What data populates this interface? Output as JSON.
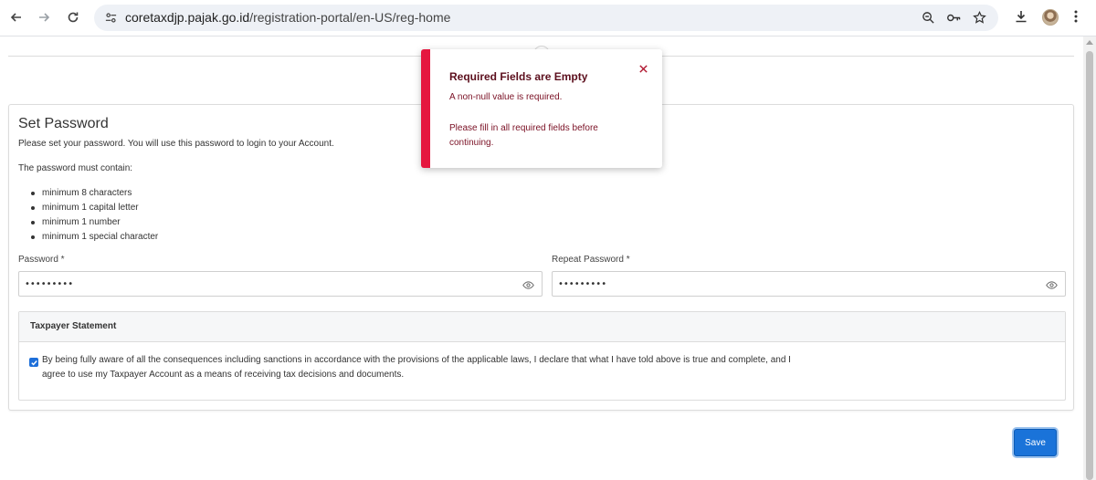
{
  "browser": {
    "url_host": "coretaxdjp.pajak.go.id",
    "url_path": "/registration-portal/en-US/reg-home",
    "icons": [
      "back-icon",
      "forward-icon",
      "reload-icon",
      "site-settings-icon",
      "zoom-icon",
      "password-key-icon",
      "bookmark-star-icon",
      "download-icon",
      "profile-avatar",
      "more-menu-icon"
    ]
  },
  "set_password": {
    "title": "Set Password",
    "intro": "Please set your password. You will use this password to login to your Account.",
    "must_contain": "The password must contain:",
    "requirements": [
      "minimum 8 characters",
      "minimum 1 capital letter",
      "minimum 1 number",
      "minimum 1 special character"
    ],
    "password_label": "Password *",
    "password_value": "•••••••••",
    "repeat_label": "Repeat Password *",
    "repeat_value": "•••••••••"
  },
  "statement": {
    "header": "Taxpayer Statement",
    "checked": true,
    "text": "By being fully aware of all the consequences including sanctions in accordance with the provisions of the applicable laws, I declare that what I have told above is true and complete, and I agree to use my Taxpayer Account as a means of receiving tax decisions and documents."
  },
  "actions": {
    "save_label": "Save"
  },
  "toast": {
    "title": "Required Fields are Empty",
    "line1": "A non-null value is required.",
    "line2": "Please fill in all required fields before continuing.",
    "accent_color": "#e5173f"
  },
  "colors": {
    "primary": "#1a73d9",
    "error": "#e5173f"
  }
}
